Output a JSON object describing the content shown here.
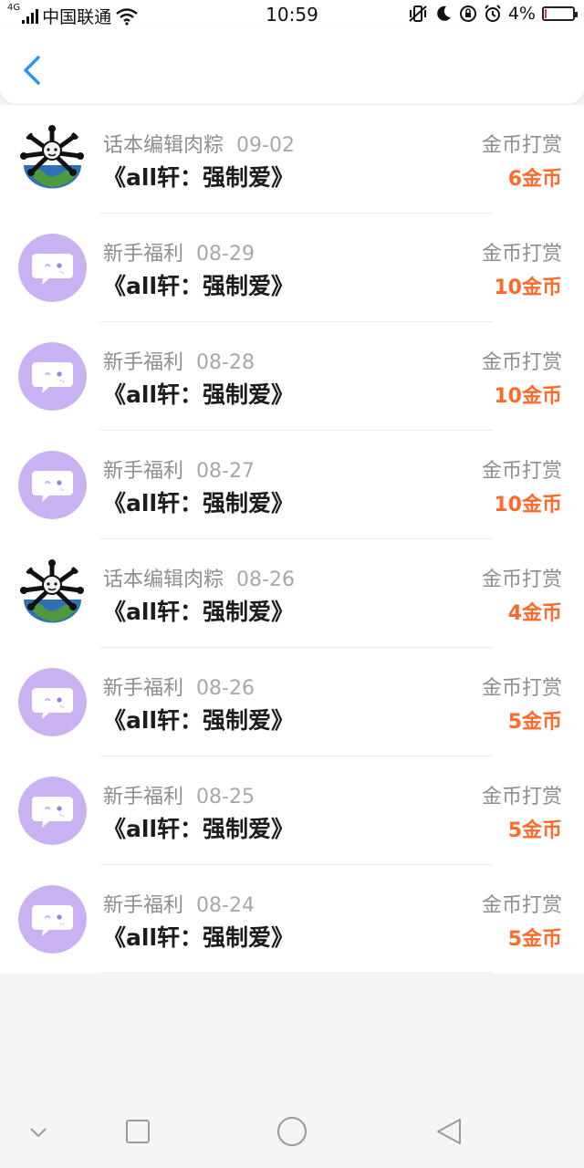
{
  "status_bar": {
    "network": "4G",
    "carrier": "中国联通",
    "time": "10:59",
    "battery": "4%",
    "battery_level": 0.04
  },
  "colors": {
    "accent": "#2b96f0",
    "amount": "#ff6a2b",
    "avatar_purple": "#c9b1f2"
  },
  "list": [
    {
      "source": "话本编辑肉粽",
      "date": "09-02",
      "title": "《all轩：强制爱》",
      "type": "金币打赏",
      "amount": "6金币",
      "avatar": "editor-avatar"
    },
    {
      "source": "新手福利",
      "date": "08-29",
      "title": "《all轩：强制爱》",
      "type": "金币打赏",
      "amount": "10金币",
      "avatar": "chat-bubble-avatar"
    },
    {
      "source": "新手福利",
      "date": "08-28",
      "title": "《all轩：强制爱》",
      "type": "金币打赏",
      "amount": "10金币",
      "avatar": "chat-bubble-avatar"
    },
    {
      "source": "新手福利",
      "date": "08-27",
      "title": "《all轩：强制爱》",
      "type": "金币打赏",
      "amount": "10金币",
      "avatar": "chat-bubble-avatar"
    },
    {
      "source": "话本编辑肉粽",
      "date": "08-26",
      "title": "《all轩：强制爱》",
      "type": "金币打赏",
      "amount": "4金币",
      "avatar": "editor-avatar"
    },
    {
      "source": "新手福利",
      "date": "08-26",
      "title": "《all轩：强制爱》",
      "type": "金币打赏",
      "amount": "5金币",
      "avatar": "chat-bubble-avatar"
    },
    {
      "source": "新手福利",
      "date": "08-25",
      "title": "《all轩：强制爱》",
      "type": "金币打赏",
      "amount": "5金币",
      "avatar": "chat-bubble-avatar"
    },
    {
      "source": "新手福利",
      "date": "08-24",
      "title": "《all轩：强制爱》",
      "type": "金币打赏",
      "amount": "5金币",
      "avatar": "chat-bubble-avatar"
    }
  ],
  "nav": {
    "icons": [
      "chevron-down-icon",
      "square-icon",
      "circle-icon",
      "triangle-back-icon"
    ]
  }
}
